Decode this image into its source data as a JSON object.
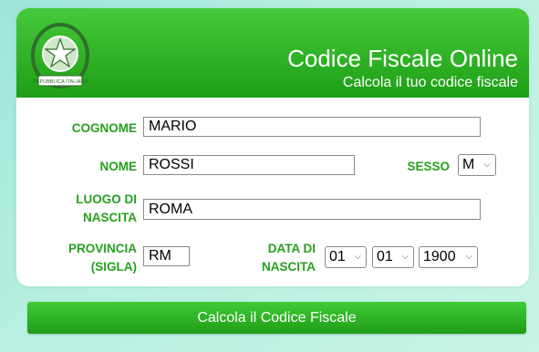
{
  "header": {
    "title": "Codice Fiscale Online",
    "subtitle": "Calcola il tuo codice fiscale",
    "emblem_text": "REPUBBLICA ITALIANA"
  },
  "form": {
    "cognome": {
      "label": "COGNOME",
      "value": "MARIO"
    },
    "nome": {
      "label": "NOME",
      "value": "ROSSI"
    },
    "sesso": {
      "label": "SESSO",
      "value": "M"
    },
    "luogo": {
      "label_line1": "LUOGO DI",
      "label_line2": "NASCITA",
      "value": "ROMA"
    },
    "provincia": {
      "label_line1": "PROVINCIA",
      "label_line2": "(SIGLA)",
      "value": "RM"
    },
    "data": {
      "label_line1": "DATA DI",
      "label_line2": "NASCITA",
      "day": "01",
      "month": "01",
      "year": "1900"
    }
  },
  "submit_label": "Calcola il Codice Fiscale",
  "colors": {
    "primary_green": "#1e9f16",
    "label_green": "#27a01e"
  }
}
